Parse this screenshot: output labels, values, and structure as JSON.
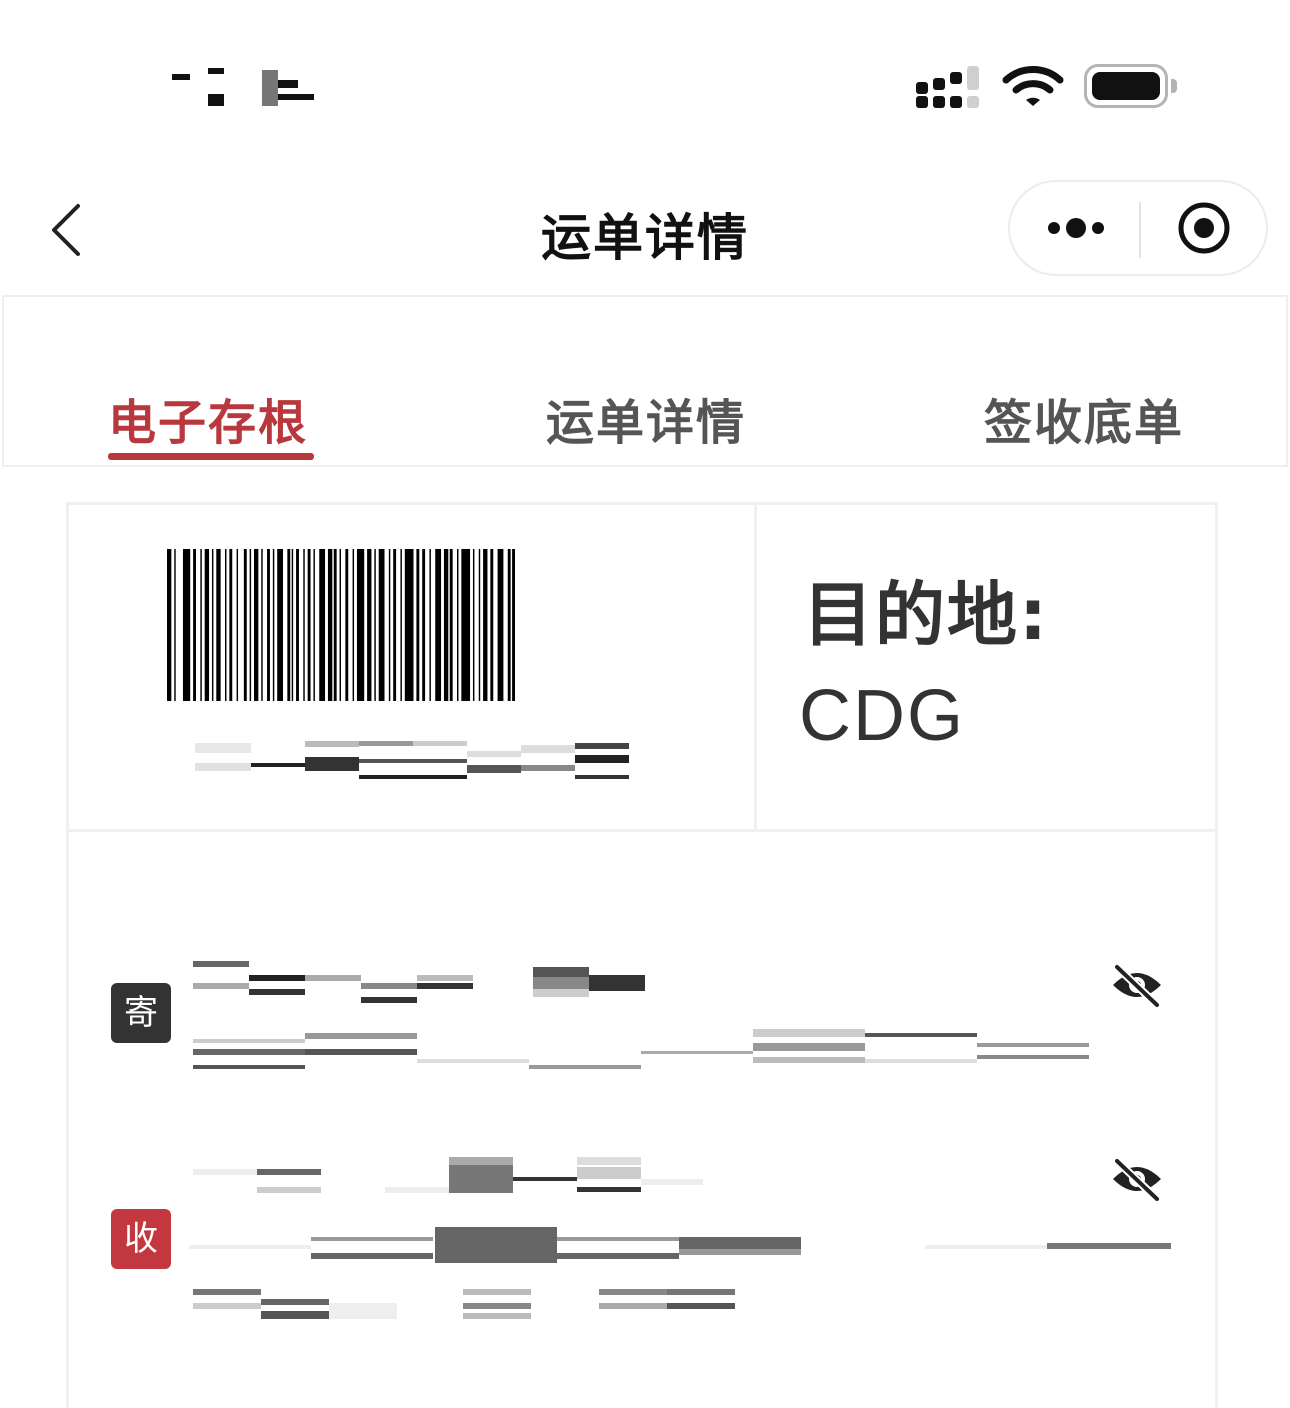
{
  "nav": {
    "title": "运单详情"
  },
  "tabs": [
    {
      "label": "电子存根",
      "active": true
    },
    {
      "label": "运单详情",
      "active": false
    },
    {
      "label": "签收底单",
      "active": false
    }
  ],
  "waybill": {
    "destination_label": "目的地:",
    "destination_code": "CDG"
  },
  "parties": {
    "sender_badge": "寄",
    "receiver_badge": "收"
  },
  "colors": {
    "accent": "#b8383e",
    "sender_badge": "#333333",
    "receiver_badge": "#c2383e"
  },
  "icons": [
    "back-chevron-icon",
    "more-dots-icon",
    "close-target-icon",
    "signal-icon",
    "wifi-icon",
    "battery-icon",
    "eye-off-icon"
  ]
}
